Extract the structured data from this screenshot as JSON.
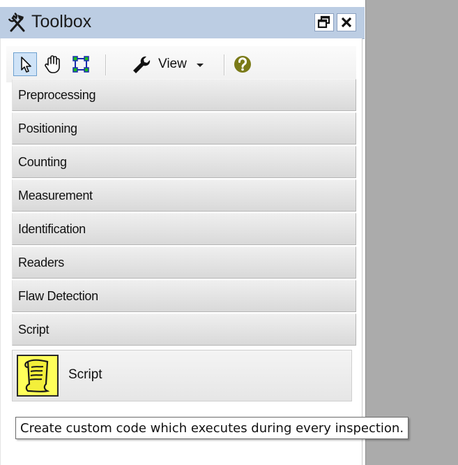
{
  "panel": {
    "title": "Toolbox",
    "title_icon": "tools-icon",
    "buttons": [
      {
        "name": "float-window-icon"
      },
      {
        "name": "close-icon"
      }
    ]
  },
  "toolbar": {
    "pointer_icon": "pointer-icon",
    "hand_icon": "pan-hand-icon",
    "roi_icon": "roi-select-icon",
    "view_icon": "wrench-icon",
    "view_label": "View",
    "help_icon": "help-icon"
  },
  "categories": [
    "Preprocessing",
    "Positioning",
    "Counting",
    "Measurement",
    "Identification",
    "Readers",
    "Flaw Detection",
    "Script"
  ],
  "expanded_tools": [
    {
      "label": "Script",
      "icon": "script-scroll-icon"
    }
  ],
  "tooltip": {
    "text": "Create custom code which executes during every inspection."
  },
  "colors": {
    "title_bar": "#bccde3",
    "right_area": "#ababab",
    "selected_tool": "#cfe3f7",
    "help_icon": "#7a7a18"
  }
}
